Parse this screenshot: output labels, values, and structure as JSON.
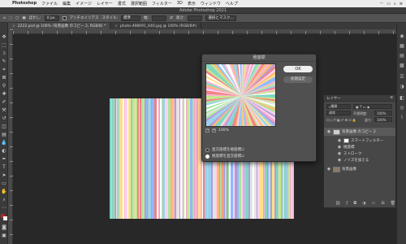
{
  "menubar": {
    "apple": "",
    "items": [
      "Photoshop",
      "ファイル",
      "編集",
      "イメージ",
      "レイヤー",
      "書式",
      "選択範囲",
      "フィルター",
      "3D",
      "表示",
      "ウィンドウ",
      "ヘルプ"
    ],
    "right_icons": [
      "wifi-icon",
      "battery-icon",
      "search-icon",
      "menu-icon"
    ]
  },
  "titlebar": {
    "title": "Adobe Photoshop 2021"
  },
  "options": {
    "feather_label": "ぼかし:",
    "feather_value": "0 px",
    "antialias_label": "アンチエイリアス",
    "style_label": "スタイル:",
    "style_value": "標準",
    "width_label": "幅:",
    "height_label": "高さ:",
    "mask_button": "選択とマスク..."
  },
  "tabs": [
    {
      "label": "2222.psd @ 100% (背景画像 のコピー 2, RGB/8) *",
      "active": true
    },
    {
      "label": "photo-498091_640.jpg @ 100% (RGB/8#)",
      "active": false
    }
  ],
  "dialog": {
    "title": "極座標",
    "ok": "OK",
    "reset": "初期設定",
    "zoom": "100%",
    "zoom_minus": "−",
    "zoom_plus": "+",
    "option1": "直交座標を極座標に",
    "option2": "極座標を直交座標に",
    "selected": 2
  },
  "layers": {
    "title": "レイヤー",
    "search": "種類",
    "blend": "通常",
    "opacity_label": "不透明度:",
    "opacity": "100%",
    "lock_label": "ロック:",
    "fill_label": "塗り:",
    "fill": "100%",
    "rows": [
      {
        "name": "背景画像 のコピー 2",
        "type": "smart"
      },
      {
        "name": "スマートフィルター",
        "type": "filter-group"
      },
      {
        "name": "極座標",
        "type": "filter"
      },
      {
        "name": "ストローク",
        "type": "filter"
      },
      {
        "name": "ノイズを加える",
        "type": "filter"
      },
      {
        "name": "背景画像",
        "type": "image"
      }
    ]
  },
  "colors": {
    "panel": "#474747",
    "workspace": "#282828",
    "accent": "#2b76d2"
  },
  "stripe_palette": [
    "#f7b6d2",
    "#9ad0ec",
    "#ffe08a",
    "#c6e58c",
    "#f08080",
    "#b19cd9",
    "#ffffff",
    "#7fd6c2",
    "#ffb870",
    "#8fb8ff",
    "#e4e4e4",
    "#f5a3c7",
    "#a8e6a1",
    "#ffd0f0"
  ]
}
